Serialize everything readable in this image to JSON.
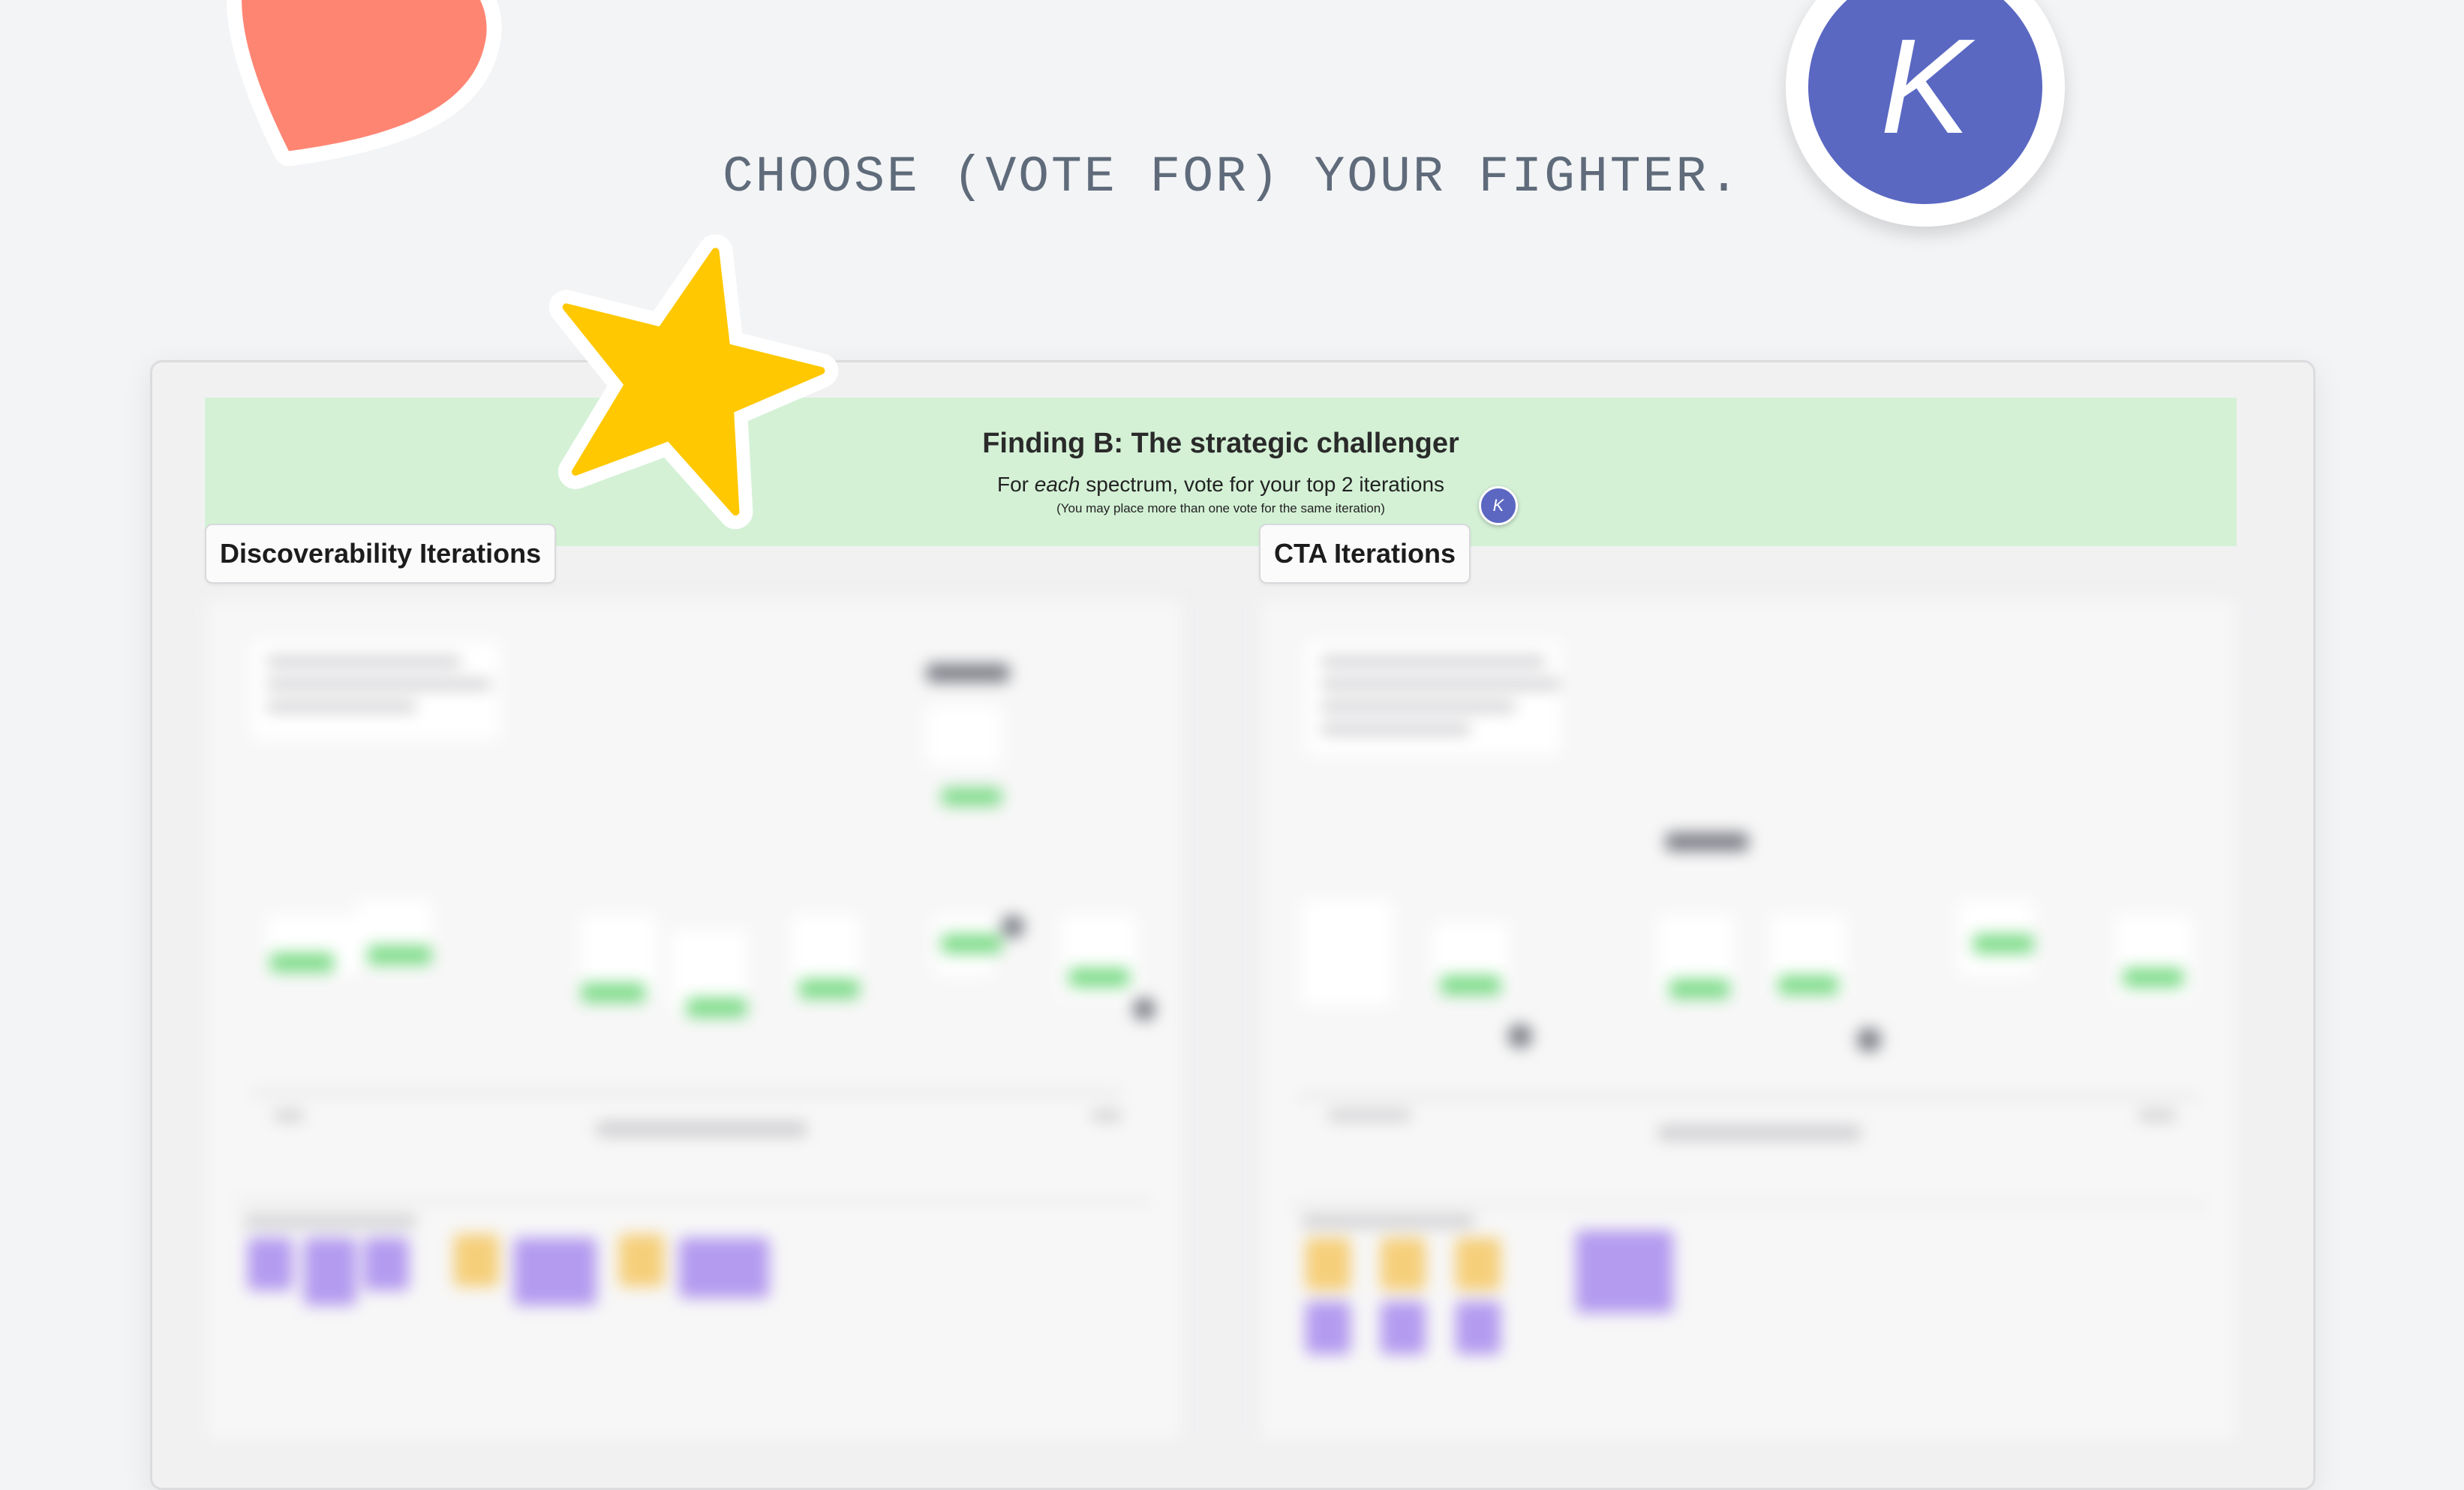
{
  "headline": "CHOOSE (VOTE FOR) YOUR FIGHTER.",
  "banner": {
    "title": "Finding B: The strategic challenger",
    "subtitle_pre": "For ",
    "subtitle_em": "each",
    "subtitle_post": " spectrum, vote for your top 2 iterations",
    "note": "(You may place more than one vote for the same iteration)"
  },
  "avatar_initial": "K",
  "sections": {
    "left_label": "Discoverability Iterations",
    "right_label": "CTA Iterations"
  },
  "colors": {
    "banner_bg": "#d4f1d6",
    "avatar": "#5b67c1",
    "heart": "#ff8573",
    "star": "#ffc800"
  },
  "stickers": [
    "heart-sticker",
    "star-sticker",
    "avatar-sticker"
  ]
}
